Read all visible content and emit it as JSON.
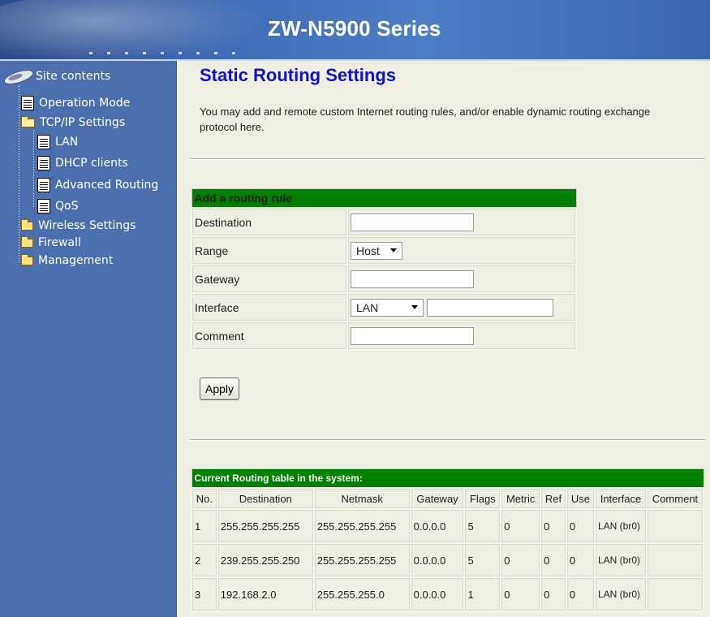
{
  "banner": {
    "title": "ZW-N5900 Series"
  },
  "sidebar": {
    "root_label": "Site contents",
    "items": [
      {
        "label": "Operation Mode",
        "icon": "document-icon"
      },
      {
        "label": "TCP/IP Settings",
        "icon": "open-folder-icon"
      },
      {
        "label": "LAN",
        "icon": "document-icon"
      },
      {
        "label": "DHCP clients",
        "icon": "document-icon"
      },
      {
        "label": "Advanced Routing",
        "icon": "document-icon"
      },
      {
        "label": "QoS",
        "icon": "document-icon"
      },
      {
        "label": "Wireless Settings",
        "icon": "folder-icon"
      },
      {
        "label": "Firewall",
        "icon": "folder-icon"
      },
      {
        "label": "Management",
        "icon": "folder-icon"
      }
    ]
  },
  "main": {
    "title": "Static Routing Settings",
    "description": "You may add and remote custom Internet routing rules, and/or enable dynamic routing exchange protocol here."
  },
  "form": {
    "section_title": "Add a routing rule",
    "destination_label": "Destination",
    "destination_value": "",
    "range_label": "Range",
    "range_value": "Host",
    "gateway_label": "Gateway",
    "gateway_value": "",
    "interface_label": "Interface",
    "interface_value": "LAN",
    "interface_custom_value": "",
    "comment_label": "Comment",
    "comment_value": "",
    "apply_label": "Apply"
  },
  "routing_table": {
    "section_title": "Current Routing table in the system:",
    "columns": [
      "No.",
      "Destination",
      "Netmask",
      "Gateway",
      "Flags",
      "Metric",
      "Ref",
      "Use",
      "Interface",
      "Comment"
    ],
    "rows": [
      {
        "no": "1",
        "destination": "255.255.255.255",
        "netmask": "255.255.255.255",
        "gateway": "0.0.0.0",
        "flags": "5",
        "metric": "0",
        "ref": "0",
        "use": "0",
        "interface": "LAN (br0)",
        "comment": ""
      },
      {
        "no": "2",
        "destination": "239.255.255.250",
        "netmask": "255.255.255.255",
        "gateway": "0.0.0.0",
        "flags": "5",
        "metric": "0",
        "ref": "0",
        "use": "0",
        "interface": "LAN (br0)",
        "comment": ""
      },
      {
        "no": "3",
        "destination": "192.168.2.0",
        "netmask": "255.255.255.0",
        "gateway": "0.0.0.0",
        "flags": "1",
        "metric": "0",
        "ref": "0",
        "use": "0",
        "interface": "LAN (br0)",
        "comment": ""
      }
    ]
  },
  "colors": {
    "section_header": "#008000",
    "sidebar": "#4a70b0",
    "title": "#1010d0",
    "page_background": "#f0efe4"
  }
}
